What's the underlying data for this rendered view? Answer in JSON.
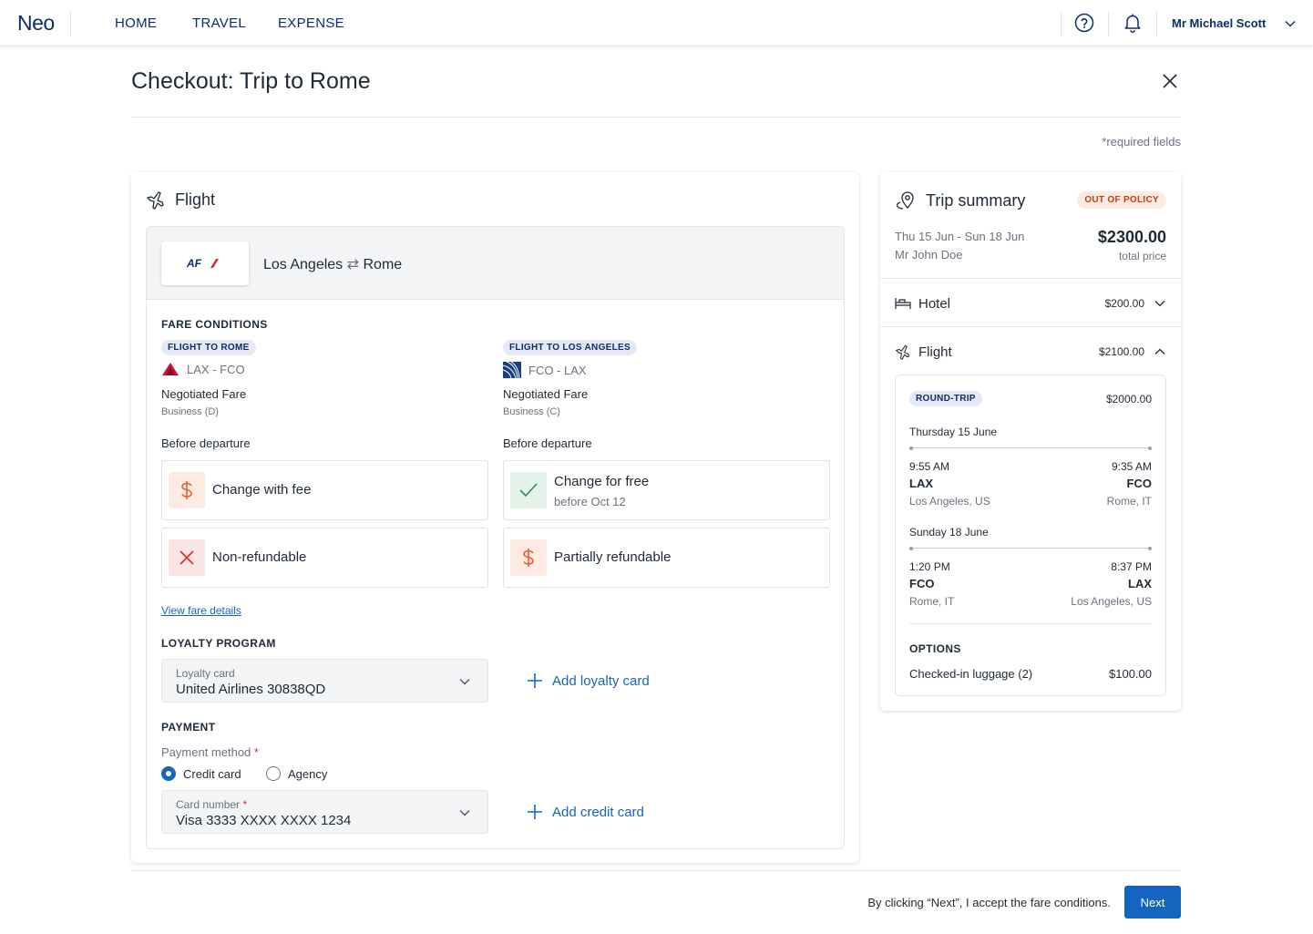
{
  "app": {
    "logo": "Neo"
  },
  "nav": {
    "home": "HOME",
    "travel": "TRAVEL",
    "expense": "EXPENSE"
  },
  "user": {
    "name": "Mr Michael Scott"
  },
  "header": {
    "title": "Checkout: Trip to Rome",
    "required_note": "*required fields"
  },
  "flight": {
    "title": "Flight",
    "airline_logo": "AF",
    "route": {
      "from": "Los Angeles",
      "arrow": "⇄",
      "to": "Rome"
    },
    "fare_conditions_label": "FARE CONDITIONS",
    "legs": [
      {
        "badge": "FLIGHT TO ROME",
        "route": "LAX - FCO",
        "fare": "Negotiated Fare",
        "fare_class": "Business (D)",
        "before_departure": "Before departure",
        "conditions": [
          {
            "icon": "dollar-icon",
            "text": "Change with fee",
            "sub": ""
          },
          {
            "icon": "x-icon",
            "text": "Non-refundable",
            "sub": ""
          }
        ]
      },
      {
        "badge": "FLIGHT TO LOS ANGELES",
        "route": "FCO - LAX",
        "fare": "Negotiated Fare",
        "fare_class": "Business (C)",
        "before_departure": "Before departure",
        "conditions": [
          {
            "icon": "check-icon",
            "text": "Change for free",
            "sub": "before Oct 12"
          },
          {
            "icon": "dollar-icon",
            "text": "Partially refundable",
            "sub": ""
          }
        ]
      }
    ],
    "view_fare_details": "View fare details",
    "loyalty": {
      "label": "LOYALTY PROGRAM",
      "field_label": "Loyalty card",
      "field_value": "United Airlines 30838QD",
      "add": "Add loyalty card"
    },
    "payment": {
      "label": "PAYMENT",
      "method_label": "Payment method",
      "required_mark": "*",
      "options": [
        "Credit card",
        "Agency"
      ],
      "selected": "Credit card",
      "card_label": "Card number",
      "card_value": "Visa 3333 XXXX XXXX 1234",
      "add": "Add credit card"
    }
  },
  "summary": {
    "title": "Trip summary",
    "policy_badge": "OUT OF POLICY",
    "dates": "Thu 15 Jun - Sun 18 Jun",
    "traveller": "Mr John Doe",
    "total": "$2300.00",
    "total_label": "total price",
    "hotel": {
      "label": "Hotel",
      "amount": "$200.00"
    },
    "flight": {
      "label": "Flight",
      "amount": "$2100.00"
    },
    "detail": {
      "badge": "ROUND-TRIP",
      "amount": "$2000.00",
      "outbound": {
        "date": "Thursday 15 June",
        "dep_time": "9:55 AM",
        "dep_code": "LAX",
        "dep_city": "Los Angeles, US",
        "arr_time": "9:35 AM",
        "arr_code": "FCO",
        "arr_city": "Rome, IT"
      },
      "return": {
        "date": "Sunday 18 June",
        "dep_time": "1:20 PM",
        "dep_code": "FCO",
        "dep_city": "Rome, IT",
        "arr_time": "8:37 PM",
        "arr_code": "LAX",
        "arr_city": "Los Angeles, US"
      },
      "options_label": "OPTIONS",
      "option_name": "Checked-in luggage (2)",
      "option_price": "$100.00"
    }
  },
  "footer": {
    "notice": "By clicking “Next”, I accept the fare conditions.",
    "next": "Next"
  },
  "colors": {
    "brand": "#0c2d6b",
    "accent": "#1565c0",
    "warning": "#c2410c",
    "success": "#2e8b57",
    "danger": "#d32f2f"
  }
}
